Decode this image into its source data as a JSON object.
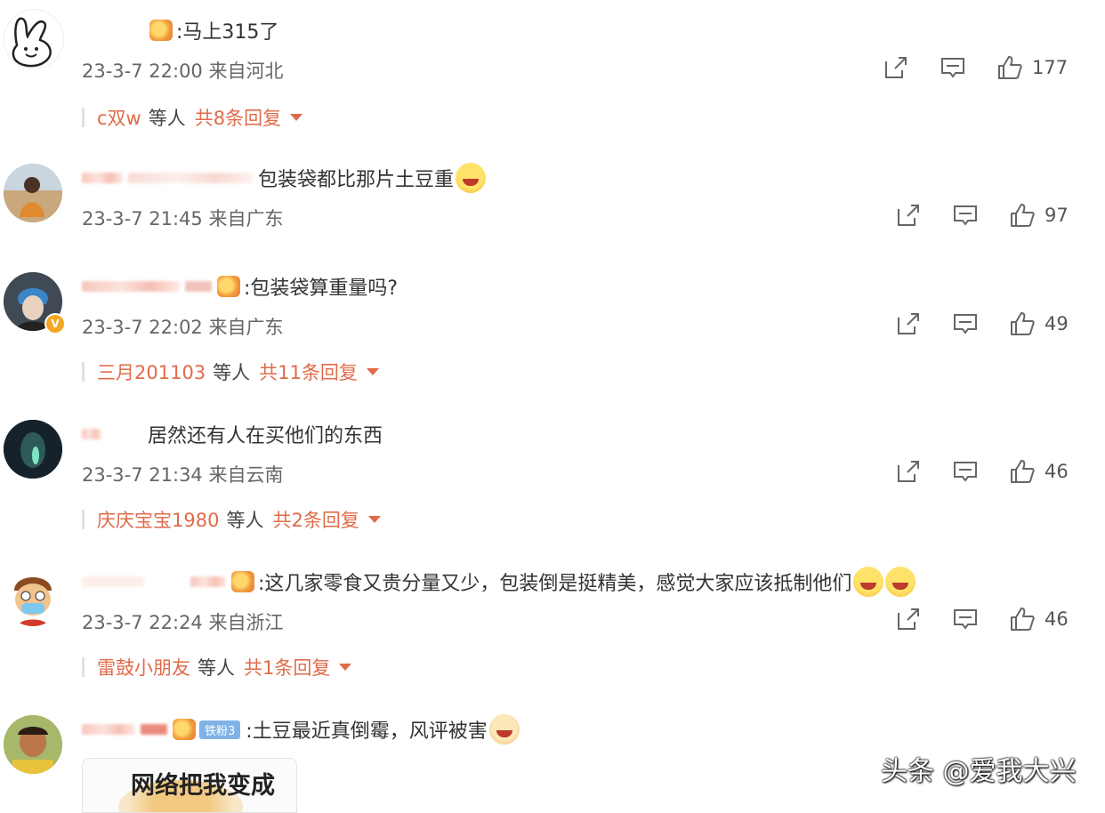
{
  "comments": [
    {
      "text": ":马上315了",
      "meta": "23-3-7 22:00 来自河北",
      "likes": "177",
      "reply": {
        "who": "c双w",
        "etc": "等人",
        "total": "共8条回复"
      }
    },
    {
      "text": "包装袋都比那片土豆重",
      "meta": "23-3-7 21:45 来自广东",
      "likes": "97"
    },
    {
      "text": ":包装袋算重量吗?",
      "meta": "23-3-7 22:02 来自广东",
      "likes": "49",
      "reply": {
        "who": "三月201103",
        "etc": "等人",
        "total": "共11条回复"
      }
    },
    {
      "text": "居然还有人在买他们的东西",
      "meta": "23-3-7 21:34 来自云南",
      "likes": "46",
      "reply": {
        "who": "庆庆宝宝1980",
        "etc": "等人",
        "total": "共2条回复"
      }
    },
    {
      "text": ":这几家零食又贵分量又少，包装倒是挺精美，感觉大家应该抵制他们",
      "meta": "23-3-7 22:24 来自浙江",
      "likes": "46",
      "reply": {
        "who": "雷鼓小朋友",
        "etc": "等人",
        "total": "共1条回复"
      }
    },
    {
      "fan_badge": "铁粉3",
      "text": ":土豆最近真倒霉，风评被害"
    }
  ],
  "quote_card_text": "网络把我变成",
  "watermark": "头条 @爱我大兴",
  "icons": [
    "share-icon",
    "comment-icon",
    "like-icon"
  ],
  "colors": {
    "reply_accent": "#e06b4a",
    "meta_text": "#666666"
  }
}
